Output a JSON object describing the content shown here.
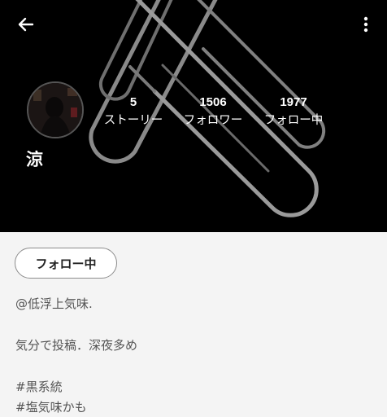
{
  "header": {
    "back_icon": "arrow-left-icon",
    "menu_icon": "more-vertical-icon"
  },
  "profile": {
    "name": "涼",
    "stats": [
      {
        "value": "5",
        "label": "ストーリー"
      },
      {
        "value": "1506",
        "label": "フォロワー"
      },
      {
        "value": "1977",
        "label": "フォロー中"
      }
    ],
    "follow_button": "フォロー中",
    "bio_lines": [
      "@低浮上気味.",
      "気分で投稿．深夜多め",
      "#黒系統",
      "#塩気味かも"
    ]
  },
  "colors": {
    "header_bg": "#000000",
    "page_bg": "#f4f4f4",
    "text_dark": "#222222",
    "text_muted": "#555555"
  }
}
